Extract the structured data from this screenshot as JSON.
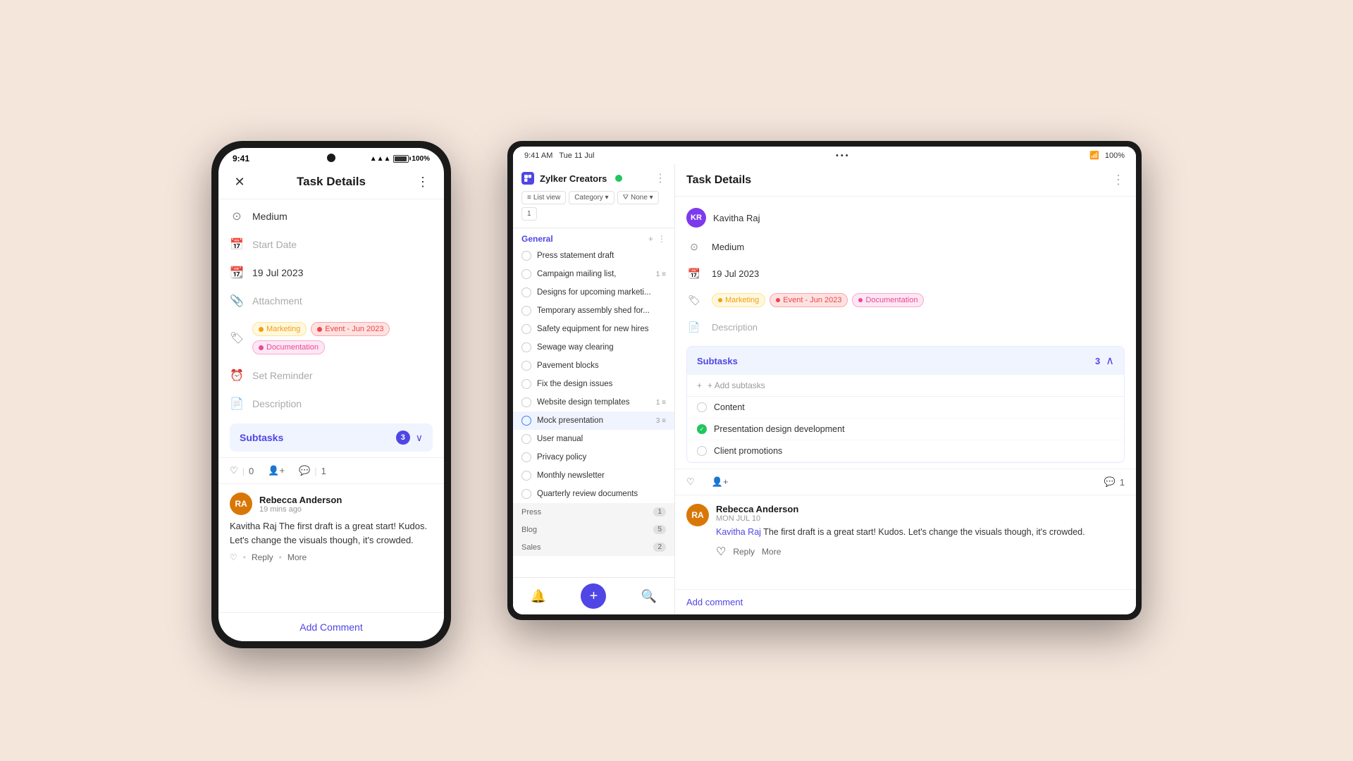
{
  "background": "#f5e6dc",
  "phone": {
    "status_time": "9:41",
    "battery": "100%",
    "header": {
      "title": "Task Details",
      "close_label": "×",
      "more_label": "⋮"
    },
    "details": [
      {
        "icon": "priority-icon",
        "label": "Medium",
        "type": "value"
      },
      {
        "icon": "start-date-icon",
        "label": "Start Date",
        "type": "placeholder"
      },
      {
        "icon": "due-date-icon",
        "label": "19 Jul 2023",
        "type": "value"
      },
      {
        "icon": "attachment-icon",
        "label": "Attachment",
        "type": "placeholder"
      },
      {
        "icon": "tags-icon",
        "type": "tags"
      },
      {
        "icon": "reminder-icon",
        "label": "Set Reminder",
        "type": "placeholder"
      },
      {
        "icon": "description-icon",
        "label": "Description",
        "type": "placeholder"
      }
    ],
    "tags": [
      {
        "label": "Marketing",
        "color": "#f59e0b",
        "bg": "#fff8e1"
      },
      {
        "label": "Event - Jun 2023",
        "color": "#ef4444",
        "bg": "#fee2e2"
      },
      {
        "label": "Documentation",
        "color": "#ec4899",
        "bg": "#fce7f3"
      }
    ],
    "subtasks": {
      "title": "Subtasks",
      "count": "3",
      "collapsed": false
    },
    "activity": {
      "likes": "0",
      "comments": "1"
    },
    "comment": {
      "author": "Rebecca Anderson",
      "time": "19 mins ago",
      "text": "Kavitha Raj The first draft is a great start! Kudos. Let's change the visuals though, it's crowded.",
      "actions": [
        "Reply",
        "More"
      ]
    },
    "add_comment_label": "Add Comment"
  },
  "tablet": {
    "status_time": "9:41 AM",
    "status_date": "Tue 11 Jul",
    "battery": "100%",
    "app_name": "Zylker Creators",
    "filters": [
      "List view",
      "Category ▾",
      "None ▾",
      "1"
    ],
    "task_list": {
      "group_general": {
        "name": "General",
        "tasks": [
          {
            "name": "Press statement draft",
            "badge": ""
          },
          {
            "name": "Campaign mailing list,",
            "badge": "1 ≡"
          },
          {
            "name": "Designs for upcoming marketi...",
            "badge": ""
          },
          {
            "name": "Temporary assembly shed for...",
            "badge": ""
          },
          {
            "name": "Safety equipment for new hires",
            "badge": ""
          },
          {
            "name": "Sewage way clearing",
            "badge": ""
          },
          {
            "name": "Pavement blocks",
            "badge": ""
          },
          {
            "name": "Fix the design issues",
            "badge": ""
          },
          {
            "name": "Website design templates",
            "badge": "1 ≡"
          },
          {
            "name": "Mock presentation",
            "badge": "3 ≡",
            "active": true
          },
          {
            "name": "User manual",
            "badge": ""
          },
          {
            "name": "Privacy policy",
            "badge": ""
          },
          {
            "name": "Monthly newsletter",
            "badge": ""
          },
          {
            "name": "Quarterly review documents",
            "badge": ""
          }
        ]
      },
      "sections": [
        {
          "name": "Press",
          "count": "1"
        },
        {
          "name": "Blog",
          "count": "5"
        },
        {
          "name": "Sales",
          "count": "2"
        }
      ]
    },
    "task_detail": {
      "title": "Task Details",
      "more_label": "⋮",
      "assignee": "Kavitha Raj",
      "priority": "Medium",
      "due_date": "19 Jul 2023",
      "tags": [
        {
          "label": "Marketing",
          "color": "#f59e0b"
        },
        {
          "label": "Event - Jun 2023",
          "color": "#ef4444"
        },
        {
          "label": "Documentation",
          "color": "#ec4899"
        }
      ],
      "description_placeholder": "Description",
      "subtasks": {
        "title": "Subtasks",
        "count": "3",
        "add_label": "+ Add subtasks",
        "items": [
          {
            "name": "Content",
            "done": false
          },
          {
            "name": "Presentation design development",
            "done": true
          },
          {
            "name": "Client promotions",
            "done": false
          }
        ]
      },
      "activity": {
        "comments": "1"
      },
      "comment": {
        "author": "Rebecca Anderson",
        "date": "MON JUL 10",
        "mention": "Kavitha Raj",
        "text": " The first draft is a great start! Kudos. Let's change the visuals though, it's crowded.",
        "actions": [
          "Reply",
          "More"
        ]
      },
      "add_comment_label": "Add comment"
    },
    "bottom_bar": {
      "items": [
        "🔔",
        "+",
        "🔍"
      ]
    }
  }
}
